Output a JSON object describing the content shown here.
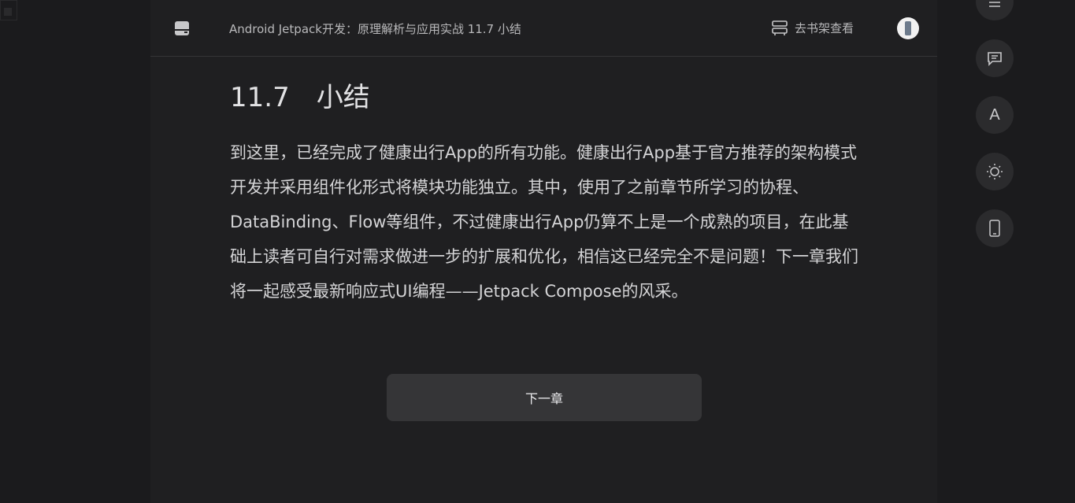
{
  "header": {
    "book_title": "Android Jetpack开发：原理解析与应用实战 11.7 小结",
    "shelf_label": "去书架查看"
  },
  "chapter": {
    "heading": "11.7　小结",
    "body": "到这里，已经完成了健康出行App的所有功能。健康出行App基于官方推荐的架构模式开发并采用组件化形式将模块功能独立。其中，使用了之前章节所学习的协程、DataBinding、Flow等组件，不过健康出行App仍算不上是一个成熟的项目，在此基础上读者可自行对需求做进一步的扩展和优化，相信这已经完全不是问题！下一章我们将一起感受最新响应式UI编程——Jetpack Compose的风采。",
    "next_label": "下一章"
  },
  "side_toolbar": {
    "font_letter": "A",
    "icons": [
      "menu-icon",
      "comment-icon",
      "font-icon",
      "brightness-icon",
      "phone-icon"
    ]
  },
  "colors": {
    "page_bg": "#1b1b1d",
    "reader_bg": "#1f1f21",
    "button_bg": "#353537",
    "text": "#d4d4d6"
  }
}
